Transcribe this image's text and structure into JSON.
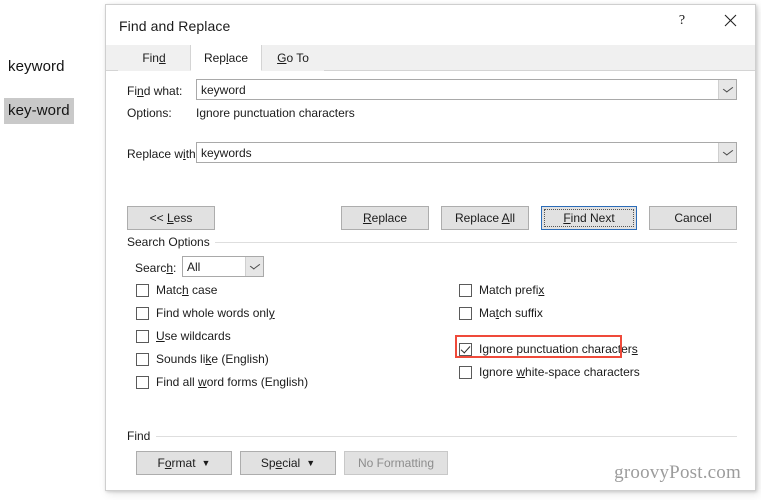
{
  "document": {
    "words": [
      {
        "text": "keyword"
      },
      {
        "text": "key-word"
      }
    ]
  },
  "dialog": {
    "title": "Find and Replace",
    "help_icon": "question-mark-icon",
    "close_icon": "close-icon",
    "tabs": [
      {
        "label": "Find",
        "active": false
      },
      {
        "label": "Replace",
        "active": true
      },
      {
        "label": "Go To",
        "active": false
      }
    ],
    "find_what": {
      "label": "Find what:",
      "value": "keyword",
      "dropdown_icon": "chevron-down-icon"
    },
    "options": {
      "label": "Options:",
      "value": "Ignore punctuation characters"
    },
    "replace_with": {
      "label": "Replace with:",
      "value": "keywords",
      "dropdown_icon": "chevron-down-icon"
    },
    "buttons": {
      "less": "<< Less",
      "replace": "Replace",
      "replace_all": "Replace All",
      "find_next": "Find Next",
      "cancel": "Cancel"
    },
    "search_options": {
      "group_label": "Search Options",
      "search_label": "Search:",
      "search_value": "All",
      "search_dropdown_icon": "chevron-down-icon",
      "left_checkboxes": [
        {
          "label": "Match case",
          "checked": false
        },
        {
          "label": "Find whole words only",
          "checked": false
        },
        {
          "label": "Use wildcards",
          "checked": false
        },
        {
          "label": "Sounds like (English)",
          "checked": false
        },
        {
          "label": "Find all word forms (English)",
          "checked": false
        }
      ],
      "right_checkboxes": [
        {
          "label": "Match prefix",
          "checked": false
        },
        {
          "label": "Match suffix",
          "checked": false
        },
        {
          "label": "Ignore punctuation characters",
          "checked": true,
          "highlighted": true
        },
        {
          "label": "Ignore white-space characters",
          "checked": false
        }
      ]
    },
    "find_group": {
      "group_label": "Find",
      "format_button": "Format",
      "special_button": "Special",
      "no_formatting_button": "No Formatting",
      "dropdown_icon": "caret-down-icon"
    }
  },
  "watermark": "groovyPost.com",
  "colors": {
    "highlight": "#ef4a3a",
    "default_button_border": "#2b6cb8",
    "selection": "#c9c9c9"
  }
}
